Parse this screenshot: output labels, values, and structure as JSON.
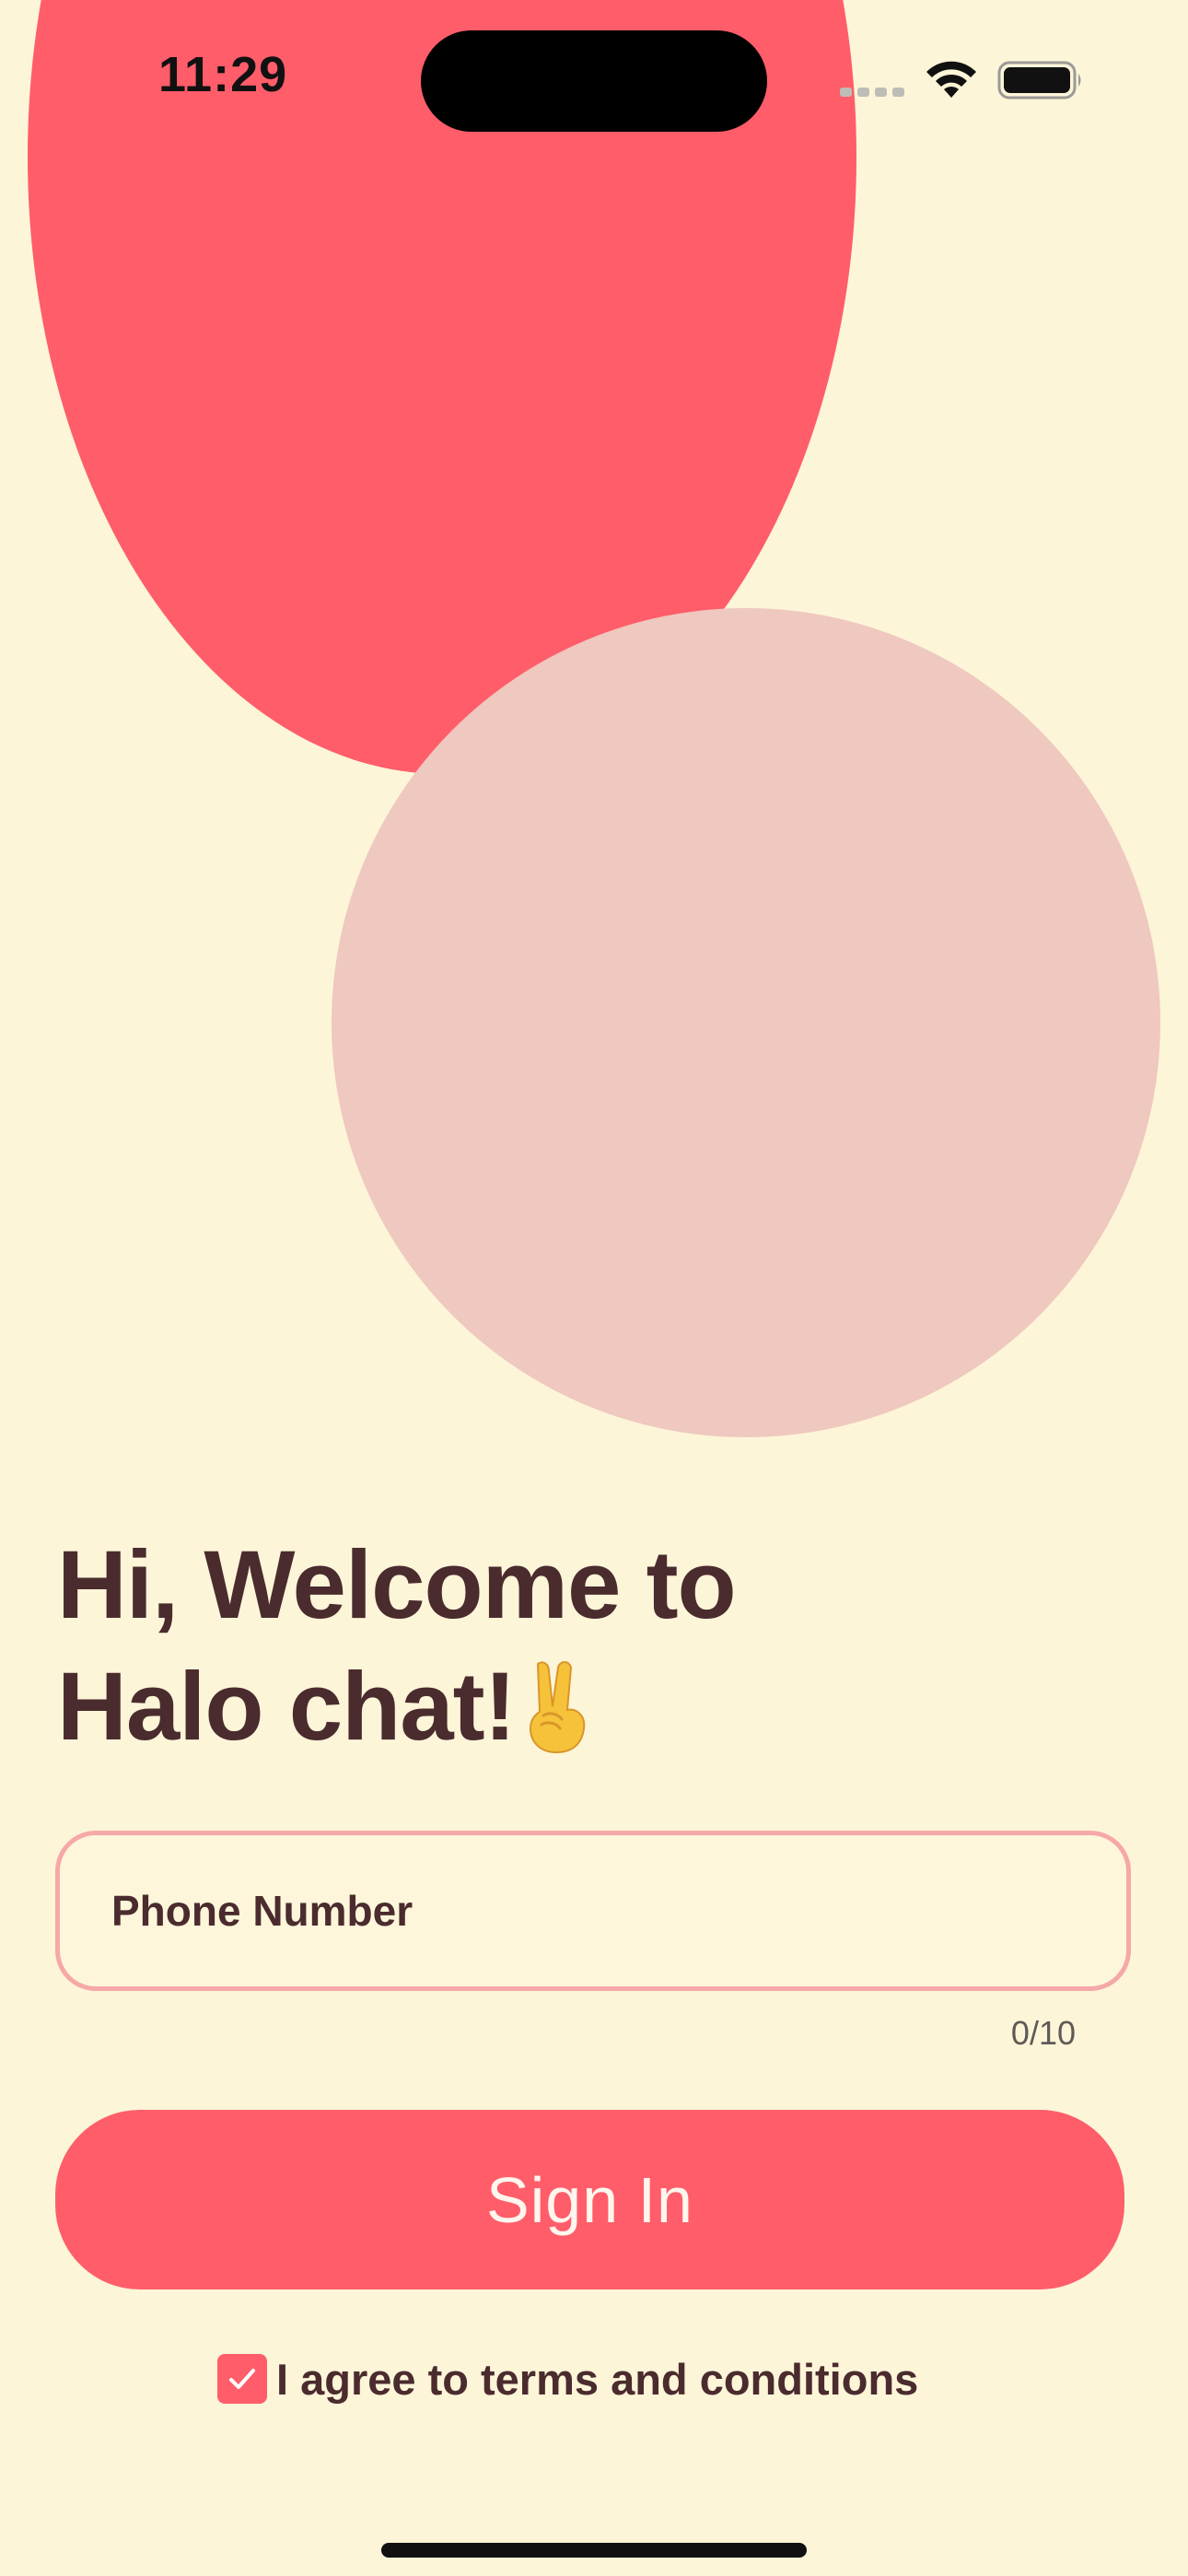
{
  "status_bar": {
    "time": "11:29",
    "icons": [
      "cellular-signal-icon",
      "wifi-icon",
      "battery-icon"
    ]
  },
  "welcome": {
    "line1": "Hi, Welcome to",
    "line2": "Halo chat!",
    "emoji": "victory-hand-emoji"
  },
  "phone_field": {
    "placeholder": "Phone Number",
    "value": "",
    "counter": "0/10"
  },
  "signin_button": {
    "label": "Sign In"
  },
  "terms": {
    "checked": true,
    "label": "I agree to terms and conditions"
  },
  "colors": {
    "background": "#FDF5D8",
    "accent": "#FF5D6A",
    "secondary_circle": "#EFC8BF",
    "field_border": "#F6A8A8",
    "text_primary": "#4A2B2E"
  }
}
